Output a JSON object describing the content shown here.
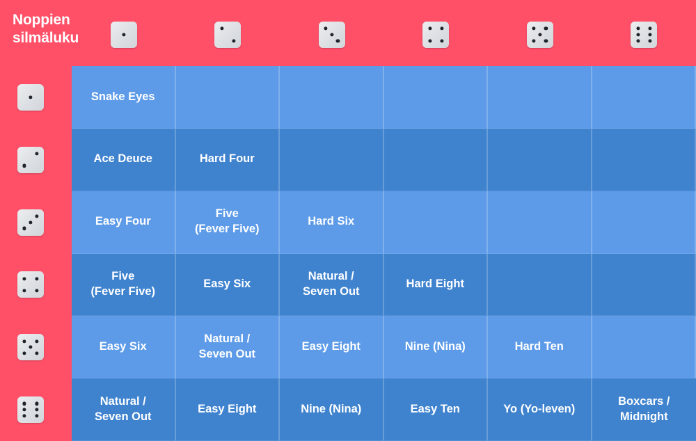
{
  "header": {
    "corner_title": "Noppien silmäluku"
  },
  "colors": {
    "background_pink": "#ff5068",
    "cell_light_blue": "#5d9be8",
    "cell_dark_blue": "#3f83cf",
    "text_white": "#ffffff",
    "die_face": "#e3e6ea",
    "die_pip": "#20242c"
  },
  "column_headers": [
    {
      "name": "die-face-1",
      "value": 1
    },
    {
      "name": "die-face-2",
      "value": 2
    },
    {
      "name": "die-face-3",
      "value": 3
    },
    {
      "name": "die-face-4",
      "value": 4
    },
    {
      "name": "die-face-5",
      "value": 5
    },
    {
      "name": "die-face-6",
      "value": 6
    }
  ],
  "row_headers": [
    {
      "name": "die-face-1",
      "value": 1
    },
    {
      "name": "die-face-2",
      "value": 2
    },
    {
      "name": "die-face-3",
      "value": 3
    },
    {
      "name": "die-face-4",
      "value": 4
    },
    {
      "name": "die-face-5",
      "value": 5
    },
    {
      "name": "die-face-6",
      "value": 6
    }
  ],
  "grid": {
    "rows": [
      {
        "row_die": 1,
        "shade": "light",
        "cells": [
          {
            "text": "Snake Eyes",
            "total": 2,
            "empty": false
          },
          {
            "text": "",
            "total": 3,
            "empty": true
          },
          {
            "text": "",
            "total": 4,
            "empty": true
          },
          {
            "text": "",
            "total": 5,
            "empty": true
          },
          {
            "text": "",
            "total": 6,
            "empty": true
          },
          {
            "text": "",
            "total": 7,
            "empty": true
          }
        ]
      },
      {
        "row_die": 2,
        "shade": "dark",
        "cells": [
          {
            "text": "Ace Deuce",
            "total": 3,
            "empty": false
          },
          {
            "text": "Hard Four",
            "total": 4,
            "empty": false
          },
          {
            "text": "",
            "total": 5,
            "empty": true
          },
          {
            "text": "",
            "total": 6,
            "empty": true
          },
          {
            "text": "",
            "total": 7,
            "empty": true
          },
          {
            "text": "",
            "total": 8,
            "empty": true
          }
        ]
      },
      {
        "row_die": 3,
        "shade": "light",
        "cells": [
          {
            "text": "Easy Four",
            "total": 4,
            "empty": false
          },
          {
            "text": "Five\n(Fever Five)",
            "total": 5,
            "empty": false
          },
          {
            "text": "Hard Six",
            "total": 6,
            "empty": false
          },
          {
            "text": "",
            "total": 7,
            "empty": true
          },
          {
            "text": "",
            "total": 8,
            "empty": true
          },
          {
            "text": "",
            "total": 9,
            "empty": true
          }
        ]
      },
      {
        "row_die": 4,
        "shade": "dark",
        "cells": [
          {
            "text": "Five\n(Fever Five)",
            "total": 5,
            "empty": false
          },
          {
            "text": "Easy Six",
            "total": 6,
            "empty": false
          },
          {
            "text": "Natural /\nSeven Out",
            "total": 7,
            "empty": false
          },
          {
            "text": "Hard Eight",
            "total": 8,
            "empty": false
          },
          {
            "text": "",
            "total": 9,
            "empty": true
          },
          {
            "text": "",
            "total": 10,
            "empty": true
          }
        ]
      },
      {
        "row_die": 5,
        "shade": "light",
        "cells": [
          {
            "text": "Easy Six",
            "total": 6,
            "empty": false
          },
          {
            "text": "Natural /\nSeven Out",
            "total": 7,
            "empty": false
          },
          {
            "text": "Easy Eight",
            "total": 8,
            "empty": false
          },
          {
            "text": "Nine (Nina)",
            "total": 9,
            "empty": false
          },
          {
            "text": "Hard Ten",
            "total": 10,
            "empty": false
          },
          {
            "text": "",
            "total": 11,
            "empty": true
          }
        ]
      },
      {
        "row_die": 6,
        "shade": "dark",
        "cells": [
          {
            "text": "Natural /\nSeven Out",
            "total": 7,
            "empty": false
          },
          {
            "text": "Easy Eight",
            "total": 8,
            "empty": false
          },
          {
            "text": "Nine (Nina)",
            "total": 9,
            "empty": false
          },
          {
            "text": "Easy Ten",
            "total": 10,
            "empty": false
          },
          {
            "text": "Yo (Yo-leven)",
            "total": 11,
            "empty": false
          },
          {
            "text": "Boxcars /\nMidnight",
            "total": 12,
            "empty": false
          }
        ]
      }
    ]
  }
}
